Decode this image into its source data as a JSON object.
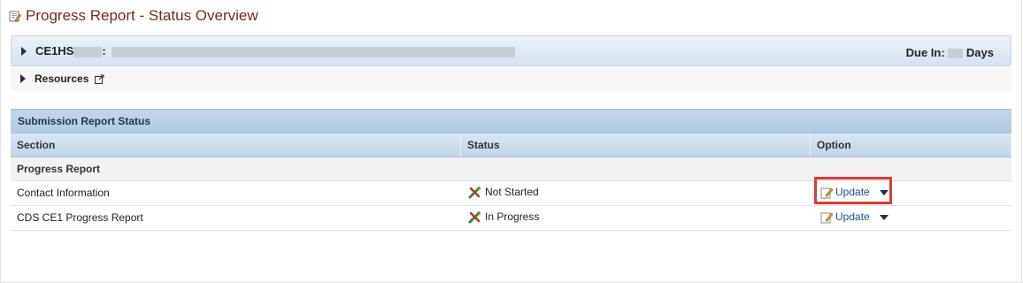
{
  "page": {
    "title": "Progress Report - Status Overview"
  },
  "header": {
    "code_prefix": "CE1HS",
    "code_separator": ":",
    "due_label": "Due In:",
    "due_unit": "Days"
  },
  "resources": {
    "label": "Resources"
  },
  "submission_table": {
    "title": "Submission Report Status",
    "columns": [
      "Section",
      "Status",
      "Option"
    ],
    "group": "Progress Report",
    "rows": [
      {
        "section": "Contact Information",
        "status": "Not Started",
        "option": "Update"
      },
      {
        "section": "CDS CE1 Progress Report",
        "status": "In Progress",
        "option": "Update"
      }
    ]
  },
  "icons": {
    "title": "report-edit-icon",
    "external": "external-link-icon",
    "status": "status-wrench-icon",
    "update": "edit-pencil-icon"
  },
  "colors": {
    "title_text": "#7a2a18",
    "link": "#1a4f96",
    "highlight": "#e03a35"
  }
}
